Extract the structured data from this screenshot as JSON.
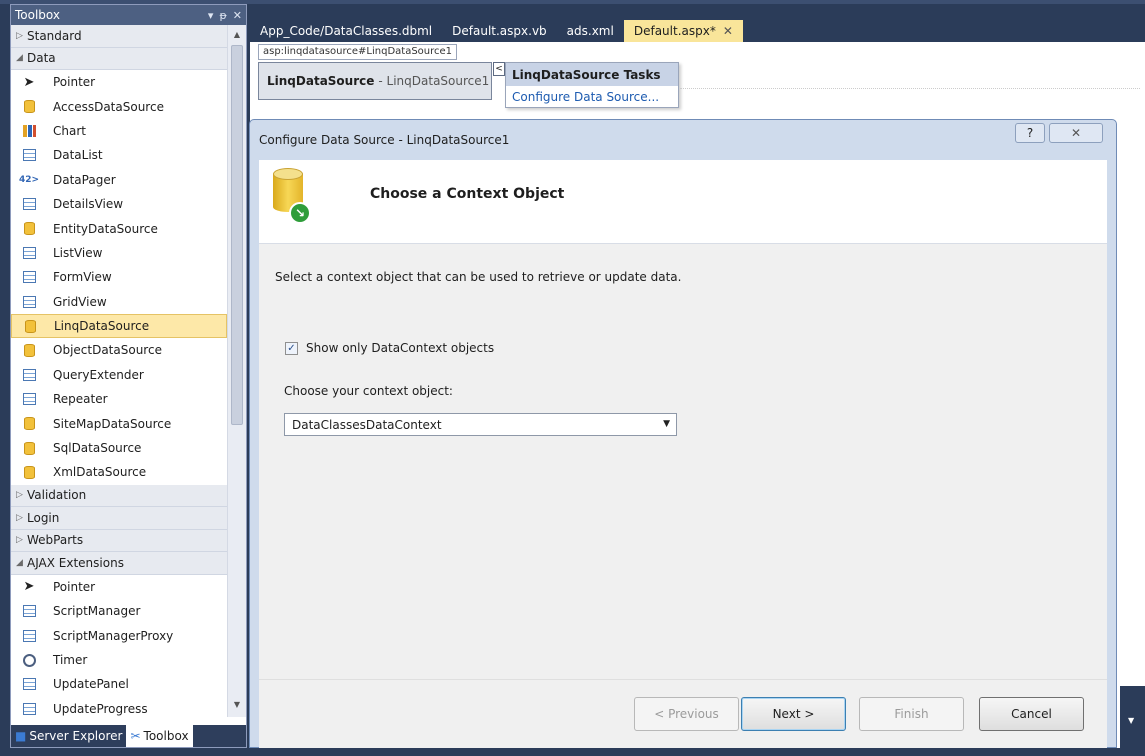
{
  "toolbox": {
    "title": "Toolbox",
    "header_buttons": [
      "▾",
      "ᵽ",
      "✕"
    ],
    "groups": [
      {
        "label": "Standard",
        "expanded": false,
        "items": []
      },
      {
        "label": "Data",
        "expanded": true,
        "items": [
          {
            "label": "Pointer",
            "icon": "pointer-icon"
          },
          {
            "label": "AccessDataSource",
            "icon": "access-datasource-icon"
          },
          {
            "label": "Chart",
            "icon": "chart-icon"
          },
          {
            "label": "DataList",
            "icon": "datalist-icon"
          },
          {
            "label": "DataPager",
            "icon": "datapager-icon"
          },
          {
            "label": "DetailsView",
            "icon": "detailsview-icon"
          },
          {
            "label": "EntityDataSource",
            "icon": "entity-datasource-icon"
          },
          {
            "label": "ListView",
            "icon": "listview-icon"
          },
          {
            "label": "FormView",
            "icon": "formview-icon"
          },
          {
            "label": "GridView",
            "icon": "gridview-icon"
          },
          {
            "label": "LinqDataSource",
            "icon": "linq-datasource-icon",
            "selected": true
          },
          {
            "label": "ObjectDataSource",
            "icon": "object-datasource-icon"
          },
          {
            "label": "QueryExtender",
            "icon": "queryextender-icon"
          },
          {
            "label": "Repeater",
            "icon": "repeater-icon"
          },
          {
            "label": "SiteMapDataSource",
            "icon": "sitemap-datasource-icon"
          },
          {
            "label": "SqlDataSource",
            "icon": "sql-datasource-icon"
          },
          {
            "label": "XmlDataSource",
            "icon": "xml-datasource-icon"
          }
        ]
      },
      {
        "label": "Validation",
        "expanded": false,
        "items": []
      },
      {
        "label": "Login",
        "expanded": false,
        "items": []
      },
      {
        "label": "WebParts",
        "expanded": false,
        "items": []
      },
      {
        "label": "AJAX Extensions",
        "expanded": true,
        "items": [
          {
            "label": "Pointer",
            "icon": "pointer-icon"
          },
          {
            "label": "ScriptManager",
            "icon": "scriptmanager-icon"
          },
          {
            "label": "ScriptManagerProxy",
            "icon": "scriptmanagerproxy-icon"
          },
          {
            "label": "Timer",
            "icon": "timer-icon"
          },
          {
            "label": "UpdatePanel",
            "icon": "updatepanel-icon"
          },
          {
            "label": "UpdateProgress",
            "icon": "updateprogress-icon"
          }
        ]
      }
    ],
    "bottom_tabs": [
      {
        "label": "Server Explorer",
        "active": false
      },
      {
        "label": "Toolbox",
        "active": true
      }
    ]
  },
  "doc_tabs": [
    {
      "label": "App_Code/DataClasses.dbml",
      "active": false
    },
    {
      "label": "Default.aspx.vb",
      "active": false
    },
    {
      "label": "ads.xml",
      "active": false
    },
    {
      "label": "Default.aspx*",
      "active": true,
      "close": "✕"
    }
  ],
  "designer": {
    "tag_label": "asp:linqdatasource#LinqDataSource1",
    "control_name": "LinqDataSource",
    "control_id": "- LinqDataSource1",
    "smart_tag_glyph": "<",
    "tasks_title": "LinqDataSource Tasks",
    "tasks_link": "Configure Data Source..."
  },
  "dialog": {
    "title": "Configure Data Source - LinqDataSource1",
    "help_glyph": "?",
    "close_glyph": "✕",
    "heading": "Choose a Context Object",
    "description": "Select a context object that can be used to retrieve or update data.",
    "checkbox_label": "Show only DataContext objects",
    "checkbox_checked": true,
    "checkbox_glyph": "✓",
    "choose_label": "Choose your context object:",
    "selected_context": "DataClassesDataContext",
    "buttons": {
      "previous": "< Previous",
      "next": "Next >",
      "finish": "Finish",
      "cancel": "Cancel"
    }
  },
  "colors": {
    "ide_background": "#2b3c59",
    "selection_highlight": "#fde8a8",
    "active_tab": "#f9e59a",
    "dialog_frame": "#cfdbec"
  }
}
